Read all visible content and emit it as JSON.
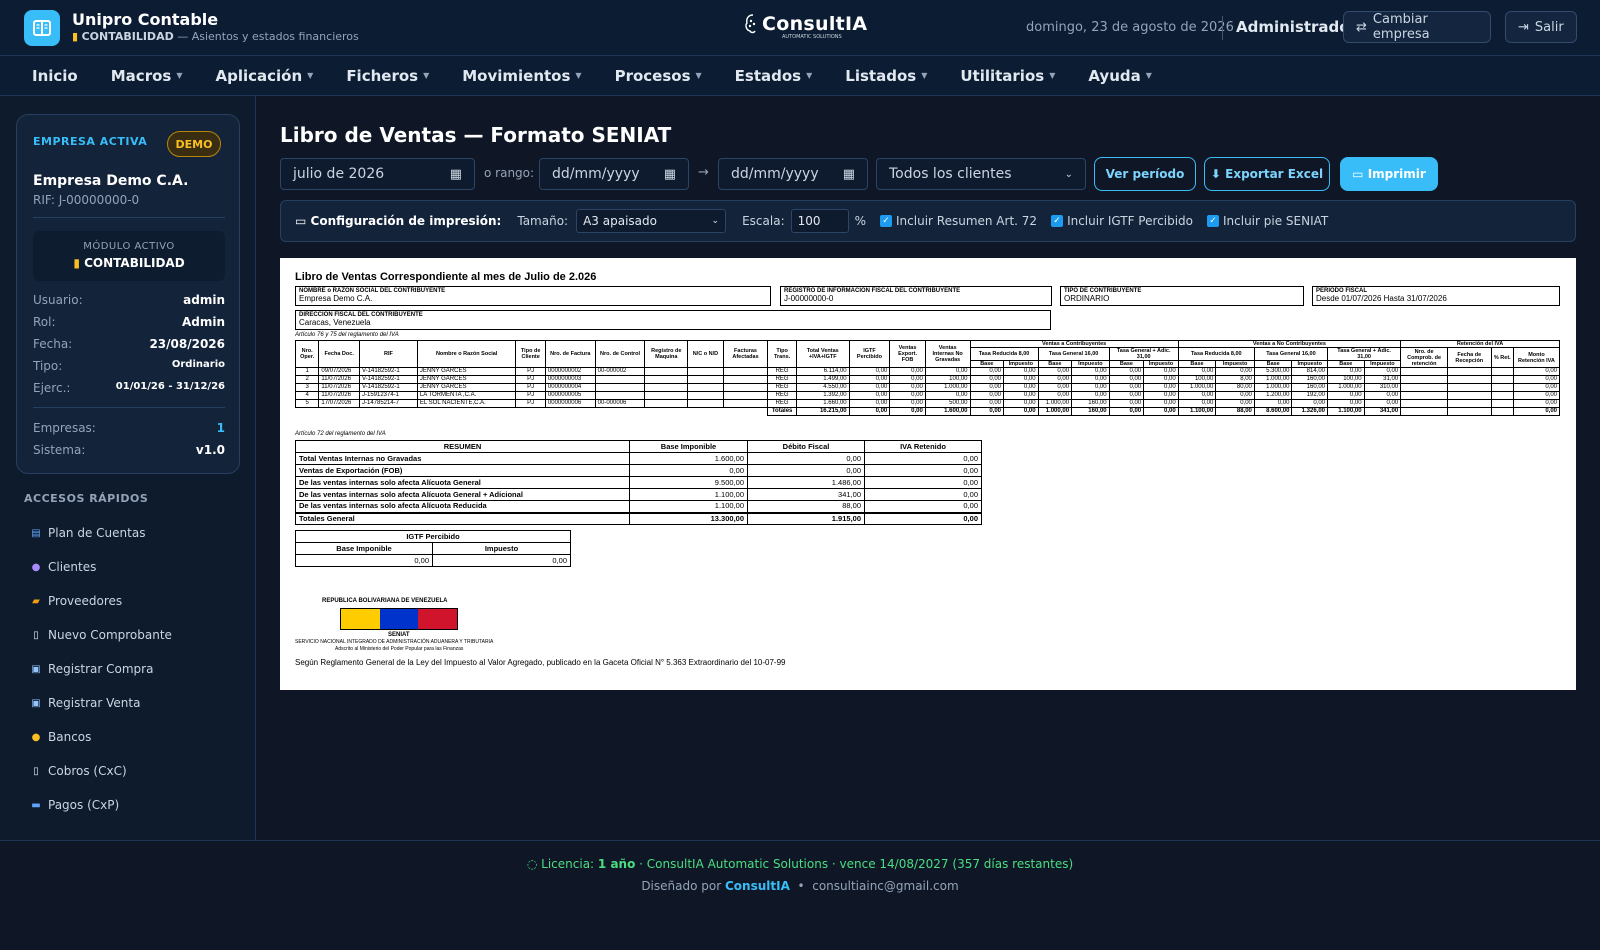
{
  "header": {
    "app_title": "Unipro Contable",
    "module": "CONTABILIDAD",
    "module_desc": "— Asientos y estados financieros",
    "brand": "ConsultIA",
    "brand_tag": "AUTOMATIC SOLUTIONS",
    "date": "domingo, 23 de agosto de 2026",
    "user": "Administrador",
    "change_company": "Cambiar empresa",
    "exit": "Salir"
  },
  "nav": [
    "Inicio",
    "Macros",
    "Aplicación",
    "Ficheros",
    "Movimientos",
    "Procesos",
    "Estados",
    "Listados",
    "Utilitarios",
    "Ayuda"
  ],
  "sidebar": {
    "active_label": "EMPRESA ACTIVA",
    "badge": "DEMO",
    "company": "Empresa Demo C.A.",
    "rif": "RIF: J-00000000-0",
    "module_label": "MÓDULO ACTIVO",
    "module_value": "CONTABILIDAD",
    "info": [
      {
        "k": "Usuario:",
        "v": "admin"
      },
      {
        "k": "Rol:",
        "v": "Admin"
      },
      {
        "k": "Fecha:",
        "v": "23/08/2026"
      },
      {
        "k": "Tipo:",
        "v": "Ordinario"
      },
      {
        "k": "Ejerc.:",
        "v": "01/01/26 - 31/12/26"
      }
    ],
    "stats": [
      {
        "k": "Empresas:",
        "v": "1"
      },
      {
        "k": "Sistema:",
        "v": "v1.0"
      }
    ],
    "quick_title": "ACCESOS RÁPIDOS",
    "quick": [
      "Plan de Cuentas",
      "Clientes",
      "Proveedores",
      "Nuevo Comprobante",
      "Registrar Compra",
      "Registrar Venta",
      "Bancos",
      "Cobros (CxC)",
      "Pagos (CxP)"
    ]
  },
  "main": {
    "title": "Libro de Ventas — Formato SENIAT",
    "period": "julio de 2026",
    "range_label": "o rango:",
    "date_ph": "dd/mm/yyyy",
    "client_filter": "Todos los clientes",
    "btn_view": "Ver período",
    "btn_excel": "⬇ Exportar Excel",
    "btn_print": "Imprimir",
    "print_cfg": {
      "label": "Configuración de impresión:",
      "size_label": "Tamaño:",
      "size": "A3 apaisado",
      "scale_label": "Escala:",
      "scale": "100",
      "pct": "%",
      "opt1": "Incluir Resumen Art. 72",
      "opt2": "Incluir IGTF Percibido",
      "opt3": "Incluir pie SENIAT"
    }
  },
  "doc": {
    "title": "Libro de Ventas Correspondiente al mes de Julio de 2.026",
    "f_name_lbl": "NOMBRE o RAZÓN SOCIAL DEL CONTRIBUYENTE",
    "f_name": "Empresa Demo C.A.",
    "f_rif_lbl": "REGISTRO DE INFORMACIÓN FISCAL DEL CONTRIBUYENTE",
    "f_rif": "J-00000000-0",
    "f_tipo_lbl": "TIPO DE CONTRIBUYENTE",
    "f_tipo": "ORDINARIO",
    "f_per_lbl": "PERIODO FISCAL",
    "f_per": "Desde 01/07/2026   Hasta 31/07/2026",
    "f_dir_lbl": "DIRECCIÓN FISCAL DEL CONTRIBUYENTE",
    "f_dir": "Caracas, Venezuela",
    "art1": "Artículo 76 y 75 del reglamento del IVA",
    "art2": "Artículo 72 del reglamento del IVA",
    "grp": {
      "contrib": "Ventas a Contribuyentes",
      "nocontrib": "Ventas a No Contribuyentes",
      "ret": "Retención del IVA"
    },
    "hdr": [
      "Nro. Oper.",
      "Fecha Doc.",
      "RIF",
      "Nombre o Razón Social",
      "Tipo de Cliente",
      "Nro. de Factura",
      "Nro. de Control",
      "Registro de Maquina",
      "N/C o N/D",
      "Facturas Afectadas",
      "Tipo Trans.",
      "Total Ventas +IVA+IGTF",
      "IGTF Percibido",
      "Ventas Export. FOB",
      "Ventas Internas No Gravadas"
    ],
    "rates": [
      "Tasa Reducida 8,00",
      "Tasa General 16,00",
      "Tasa General + Adic. 31,00",
      "Tasa Reducida 8,00",
      "Tasa General 16,00",
      "Tasa General + Adic. 31,00"
    ],
    "ret_hdr": [
      "Nro. de Comprob. de retención",
      "Fecha de Recepción",
      "% Ret.",
      "Monto Retención IVA"
    ],
    "sub": [
      "Base",
      "Impuesto"
    ],
    "rows": [
      [
        "1",
        "09/07/2026",
        "V-14182592-1",
        "JENNY GARCES",
        "PJ",
        "0000000002",
        "00-000002",
        "",
        "",
        "",
        "REG",
        "6.114,00",
        "0,00",
        "0,00",
        "0,00",
        "0,00",
        "0,00",
        "0,00",
        "0,00",
        "0,00",
        "0,00",
        "0,00",
        "0,00",
        "5.300,00",
        "814,00",
        "0,00",
        "0,00",
        "",
        "",
        "",
        "0,00"
      ],
      [
        "2",
        "11/07/2026",
        "V-14182592-1",
        "JENNY GARCES",
        "PJ",
        "0000000003",
        "",
        "",
        "",
        "",
        "REG",
        "1.499,00",
        "0,00",
        "0,00",
        "100,00",
        "0,00",
        "0,00",
        "0,00",
        "0,00",
        "0,00",
        "0,00",
        "100,00",
        "8,00",
        "1.000,00",
        "160,00",
        "100,00",
        "31,00",
        "",
        "",
        "",
        "0,00"
      ],
      [
        "3",
        "11/07/2026",
        "V-14182592-1",
        "JENNY GARCES",
        "PJ",
        "0000000004",
        "",
        "",
        "",
        "",
        "REG",
        "4.550,00",
        "0,00",
        "0,00",
        "1.000,00",
        "0,00",
        "0,00",
        "0,00",
        "0,00",
        "0,00",
        "0,00",
        "1.000,00",
        "80,00",
        "1.000,00",
        "160,00",
        "1.000,00",
        "310,00",
        "",
        "",
        "",
        "0,00"
      ],
      [
        "4",
        "11/07/2026",
        "J-15912374-1",
        "LA TORMENTA ,C.A.",
        "PJ",
        "0000000005",
        "",
        "",
        "",
        "",
        "REG",
        "1.392,00",
        "0,00",
        "0,00",
        "0,00",
        "0,00",
        "0,00",
        "0,00",
        "0,00",
        "0,00",
        "0,00",
        "0,00",
        "0,00",
        "1.200,00",
        "192,00",
        "0,00",
        "0,00",
        "",
        "",
        "",
        "0,00"
      ],
      [
        "5",
        "17/07/2026",
        "J-14785214-7",
        "EL SOL NACIENTE,C.A.",
        "PJ",
        "0000000006",
        "00-000006",
        "",
        "",
        "",
        "REG",
        "1.660,00",
        "0,00",
        "0,00",
        "500,00",
        "0,00",
        "0,00",
        "1.000,00",
        "160,00",
        "0,00",
        "0,00",
        "0,00",
        "0,00",
        "0,00",
        "0,00",
        "0,00",
        "0,00",
        "",
        "",
        "",
        "0,00"
      ]
    ],
    "totals": [
      "Totales",
      "16.215,00",
      "0,00",
      "0,00",
      "1.600,00",
      "0,00",
      "0,00",
      "1.000,00",
      "160,00",
      "0,00",
      "0,00",
      "1.100,00",
      "88,00",
      "8.600,00",
      "1.326,00",
      "1.100,00",
      "341,00",
      "",
      "",
      "",
      "0,00"
    ],
    "resumen": {
      "hdr": [
        "RESUMEN",
        "Base Imponible",
        "Débito Fiscal",
        "IVA Retenido"
      ],
      "rows": [
        [
          "Total Ventas Internas no Gravadas",
          "1.600,00",
          "0,00",
          "0,00"
        ],
        [
          "Ventas de Exportación (FOB)",
          "0,00",
          "0,00",
          "0,00"
        ],
        [
          "De las ventas internas solo afecta Alícuota General",
          "9.500,00",
          "1.486,00",
          "0,00"
        ],
        [
          "De las ventas internas solo afecta Alícuota General + Adicional",
          "1.100,00",
          "341,00",
          "0,00"
        ],
        [
          "De las ventas internas solo afecta Alícuota Reducida",
          "1.100,00",
          "88,00",
          "0,00"
        ],
        [
          "Totales General",
          "13.300,00",
          "1.915,00",
          "0,00"
        ]
      ]
    },
    "igtf": {
      "title": "IGTF Percibido",
      "hdr": [
        "Base Imponible",
        "Impuesto"
      ],
      "vals": [
        "0,00",
        "0,00"
      ]
    },
    "seniat_title": "REPUBLICA BOLIVARIANA DE VENEZUELA",
    "seniat": "SENIAT",
    "seniat_sub": "SERVICIO NACIONAL INTEGRADO DE ADMINISTRACIÓN ADUANERA Y TRIBUTARIA",
    "seniat_sub2": "Adscrito al Ministerio del Poder Popular para las Finanzas",
    "legal": "Según Reglamento General de la Ley del Impuesto al Valor Agregado, publicado en la Gaceta Oficial N° 5.363 Extraordinario del 10-07-99",
    "flag_colors": [
      "#ffcc00",
      "#0033cc",
      "#cf142b"
    ]
  },
  "footer": {
    "lic_a": "Licencia:",
    "lic_b": "1 año",
    "lic_c": "· ConsultIA Automatic Solutions · vence 14/08/2027 (357 días restantes)",
    "designed": "Diseñado por",
    "designer": "ConsultIA",
    "dot": "•",
    "email": "consultiainc@gmail.com"
  }
}
